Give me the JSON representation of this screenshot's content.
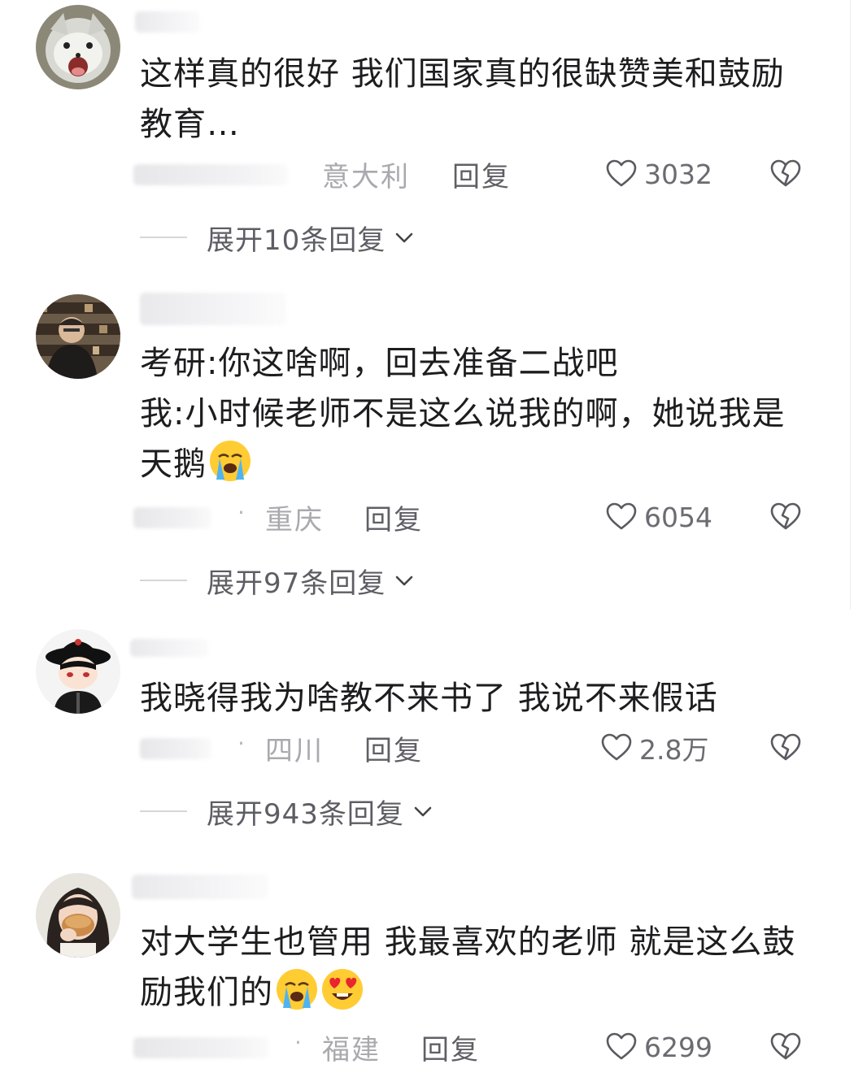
{
  "comments": [
    {
      "text": "这样真的很好 我们国家真的很缺赞美和鼓励教育…",
      "location": "意大利",
      "reply_label": "回复",
      "likes": "3032",
      "expand_label": "展开10条回复",
      "avatar_icon": "fox-avatar-icon"
    },
    {
      "text": "考研:你这啥啊，回去准备二战吧\n我:小时候老师不是这么说我的啊，她说我是天鹅",
      "location": "重庆",
      "reply_label": "回复",
      "likes": "6054",
      "expand_label": "展开97条回复",
      "avatar_icon": "man-bookshelf-avatar-icon"
    },
    {
      "text": "我晓得我为啥教不来书了 我说不来假话",
      "location": "四川",
      "reply_label": "回复",
      "likes": "2.8万",
      "expand_label": "展开943条回复",
      "avatar_icon": "cartoon-hat-avatar-icon"
    },
    {
      "text": "对大学生也管用 我最喜欢的老师 就是这么鼓励我们的",
      "location": "福建",
      "reply_label": "回复",
      "likes": "6299",
      "avatar_icon": "girl-eating-avatar-icon"
    }
  ],
  "icons": {
    "like": "heart-outline-icon",
    "dislike": "broken-heart-icon",
    "expand": "chevron-down-icon",
    "crying_emoji": "loudly-crying-face-emoji",
    "heart_eyes_emoji": "heart-eyes-face-emoji"
  },
  "colors": {
    "text": "#1d1d1f",
    "location": "#a9a9ae",
    "meta": "#5f5f66",
    "divider": "#d6d6da"
  }
}
